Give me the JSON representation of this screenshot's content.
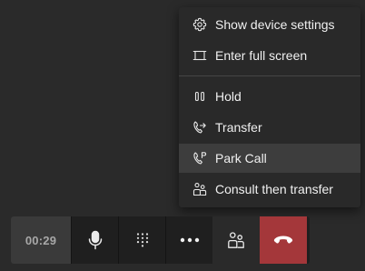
{
  "menu": {
    "items": [
      {
        "label": "Show device settings",
        "icon": "gear-icon"
      },
      {
        "label": "Enter full screen",
        "icon": "fullscreen-icon"
      },
      {
        "label": "Hold",
        "icon": "pause-icon"
      },
      {
        "label": "Transfer",
        "icon": "transfer-icon"
      },
      {
        "label": "Park Call",
        "icon": "park-call-icon"
      },
      {
        "label": "Consult then transfer",
        "icon": "consult-transfer-icon"
      }
    ],
    "highlighted_item": "Park Call"
  },
  "callbar": {
    "timer": "00:29",
    "buttons": [
      {
        "name": "microphone",
        "icon": "microphone-icon"
      },
      {
        "name": "dialpad",
        "icon": "dialpad-icon"
      },
      {
        "name": "more-actions",
        "icon": "more-icon"
      },
      {
        "name": "participants",
        "icon": "people-icon"
      },
      {
        "name": "hang-up",
        "icon": "hang-up-icon"
      }
    ]
  },
  "colors": {
    "background": "#2a2a2a",
    "menu_background": "#292929",
    "menu_highlight": "#3d3d3d",
    "hangup": "#a4373a",
    "timer_text": "#a8a8a8"
  }
}
